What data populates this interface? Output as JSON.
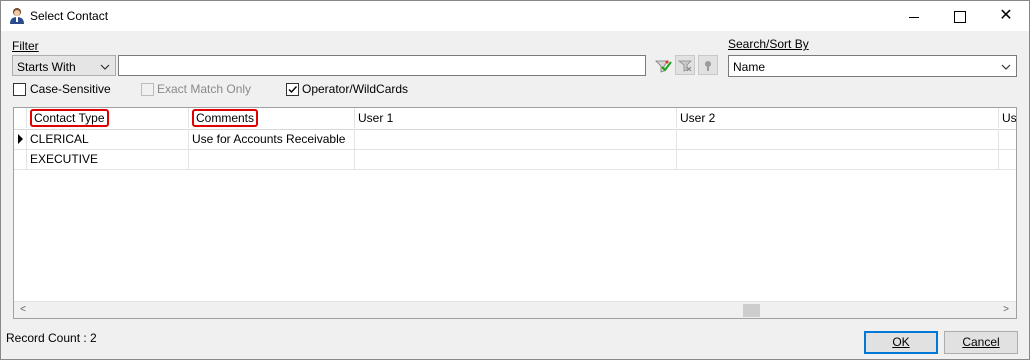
{
  "window": {
    "title": "Select Contact",
    "icon": "contact-person-icon",
    "controls": [
      "minimize-icon",
      "maximize-icon",
      "close-icon"
    ]
  },
  "filter": {
    "label": "Filter",
    "mode_selected": "Starts With",
    "text_value": "",
    "tool_icons": [
      "apply-filter-icon",
      "clear-filter-icon",
      "filter-options-icon"
    ]
  },
  "search_sort": {
    "label": "Search/Sort By",
    "selected": "Name"
  },
  "options": {
    "case_sensitive": {
      "label": "Case-Sensitive",
      "checked": false,
      "enabled": true
    },
    "exact_match": {
      "label": "Exact Match Only",
      "checked": false,
      "enabled": false
    },
    "operator_wildcards": {
      "label": "Operator/WildCards",
      "checked": true,
      "enabled": true
    }
  },
  "grid": {
    "columns": [
      "Contact Type",
      "Comments",
      "User 1",
      "User 2",
      "Us"
    ],
    "highlighted_columns": [
      "Contact Type",
      "Comments"
    ],
    "rows": [
      {
        "current": true,
        "cells": [
          "CLERICAL",
          "Use for Accounts Receivable",
          "",
          "",
          ""
        ]
      },
      {
        "current": false,
        "cells": [
          "EXECUTIVE",
          "",
          "",
          "",
          ""
        ]
      }
    ],
    "scroll_left_glyph": "<",
    "scroll_right_glyph": ">"
  },
  "footer": {
    "record_count": "Record Count : 2",
    "ok_label": "OK",
    "cancel_label": "Cancel"
  },
  "colors": {
    "highlight_box": "#e00000",
    "default_button_border": "#0078d7"
  }
}
